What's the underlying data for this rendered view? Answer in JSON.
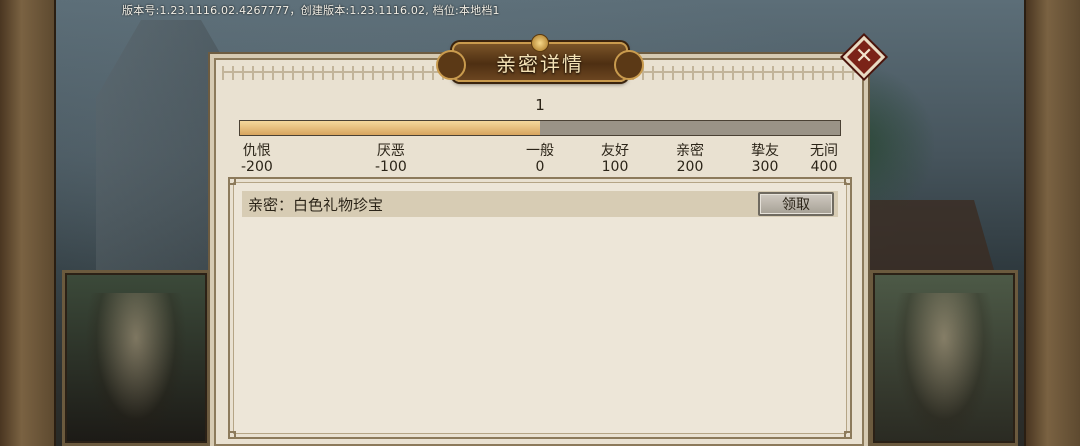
{
  "version_info": "版本号:1.23.1116.02.4267777，创建版本:1.23.1116.02, 档位:本地档1",
  "dialog": {
    "title": "亲密详情",
    "close_symbol": "✕",
    "level": "1",
    "progress_fraction": 0.5
  },
  "scale": [
    {
      "label": "仇恨",
      "value": "-200"
    },
    {
      "label": "厌恶",
      "value": "-100"
    },
    {
      "label": "一般",
      "value": "0"
    },
    {
      "label": "友好",
      "value": "100"
    },
    {
      "label": "亲密",
      "value": "200"
    },
    {
      "label": "挚友",
      "value": "300"
    },
    {
      "label": "无间",
      "value": "400"
    }
  ],
  "reward": {
    "label": "亲密：白色礼物珍宝",
    "button": "领取"
  },
  "colors": {
    "bar_fill": "#e8bf7e",
    "bar_empty": "#9a9387",
    "panel_bg": "#e9e1d1",
    "title_plate": "#5b3916",
    "close_button": "#7b2318"
  }
}
